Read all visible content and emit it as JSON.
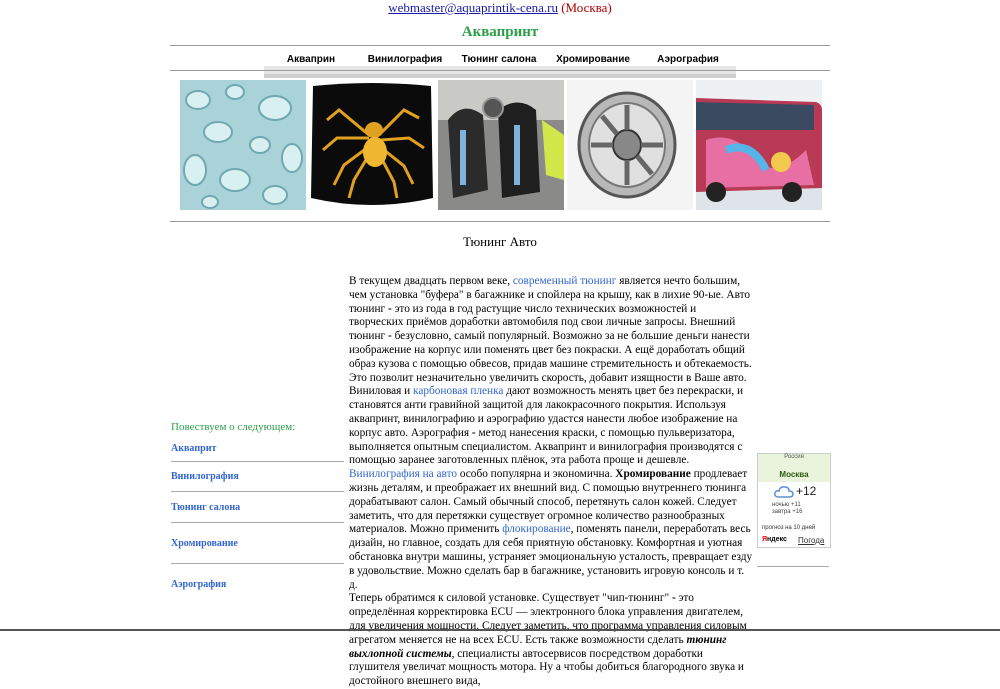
{
  "header": {
    "email": "webmaster@aquaprintik-cena.ru",
    "city": "(Москва)",
    "site_title": "Аквапринт"
  },
  "nav": {
    "items": [
      "Акваприн",
      "Винилография",
      "Тюнинг салона",
      "Хромирование",
      "Аэрография"
    ]
  },
  "page_heading": "Тюнинг Авто",
  "sidebar": {
    "heading": "Повествуем о следующем:",
    "links": [
      "Аквaприт",
      "Винилография",
      "Тюнинг салона",
      "Хромирование",
      "Аэрография"
    ]
  },
  "article": {
    "p1_a": "В текущем двадцать первом веке, ",
    "link_tuning": "современный тюнинг",
    "p1_b": " является нечто большим, чем установка \"буфера\" в багажнике и спойлера на крышу, как в лихие 90-ые. Авто тюнинг ",
    "dash1": "-",
    "p1_c": " это из года в год растущие число технических возможностей и творческих приёмов доработки автомобиля под свои личные запросы. Внешний тюнинг ",
    "dash2": "-",
    "p1_d": " безусловно, самый популярный. Возможно за не большие деньги нанести изображение на корпус или поменять цвет без покраски. А ещё доработать общий образ кузова с помощью обвесов, придав машине стремительность и обтекаемость. Это позволит незначительно увеличить скорость, добавит изящности в Ваше авто. Виниловая и ",
    "link_carbon": "карбоновая пленка",
    "p1_e": " дают возможность менять цвет без перекраски, и становятся анти гравийной защитой для лакокрасочного покрытия. Используя аквапринт, винилографию и аэрографию удастся нанести любое изображение на корпус авто. Аэрография ",
    "dash3": "-",
    "p1_f": " метод нанесения краски, с помощью пульверизатора, выполняется опытным специалистом. Аквапринт и винилография производятся с помощью заранее заготовленных плёнок, эта работа проще и дешевле. ",
    "link_vinyl": "Винилография на авто",
    "p1_g": " особо популярна и экономична. ",
    "bold_chrome": "Хромирование",
    "p1_h": " продлевает жизнь деталям, и преображает их внешний вид. С помощью внутреннего тюнинга дорабатывают салон. Самый обычный способ, перетянуть салон кожей. Следует заметить, что для перетяжки существует огромное количество разнообразных материалов. Можно применить ",
    "link_flock": "флокирование",
    "p1_i": ", поменять панели, переработать весь дизайн, но главное, создать для себя приятную обстановку. Комфортная и уютная обстановка внутри машины, устраняет эмоциональную усталость, превращает езду в удовольствие. Можно сделать бар в багажнике, установить игровую консоль и т. д.",
    "p2_a": "Теперь обратимся к силовой установке. Существует \"чип-тюнинг\" ",
    "dash4": "-",
    "p2_b": " это определённая корректировка ECU — электронного блока управления двигателем, для увеличения мощности. Следует заметить, что программа управления силовым агрегатом меняется не на всех ECU. Есть также возможности сделать ",
    "bold_exhaust": "тюнинг выхлопной системы",
    "p2_c": ", специалисты автосервисов посредством доработки глушителя увеличат мощность мотора. Ну а чтобы добиться благородного звука и достойного внешнего вида,"
  },
  "weather": {
    "country": "Россия",
    "city": "Москва",
    "temp": "+12",
    "night": "ночью +11",
    "tomorrow": "завтра +16",
    "ten_days": "прогноз на 10 дней",
    "brand_y": "Я",
    "brand_rest": "ндекс",
    "link": "Погода"
  }
}
